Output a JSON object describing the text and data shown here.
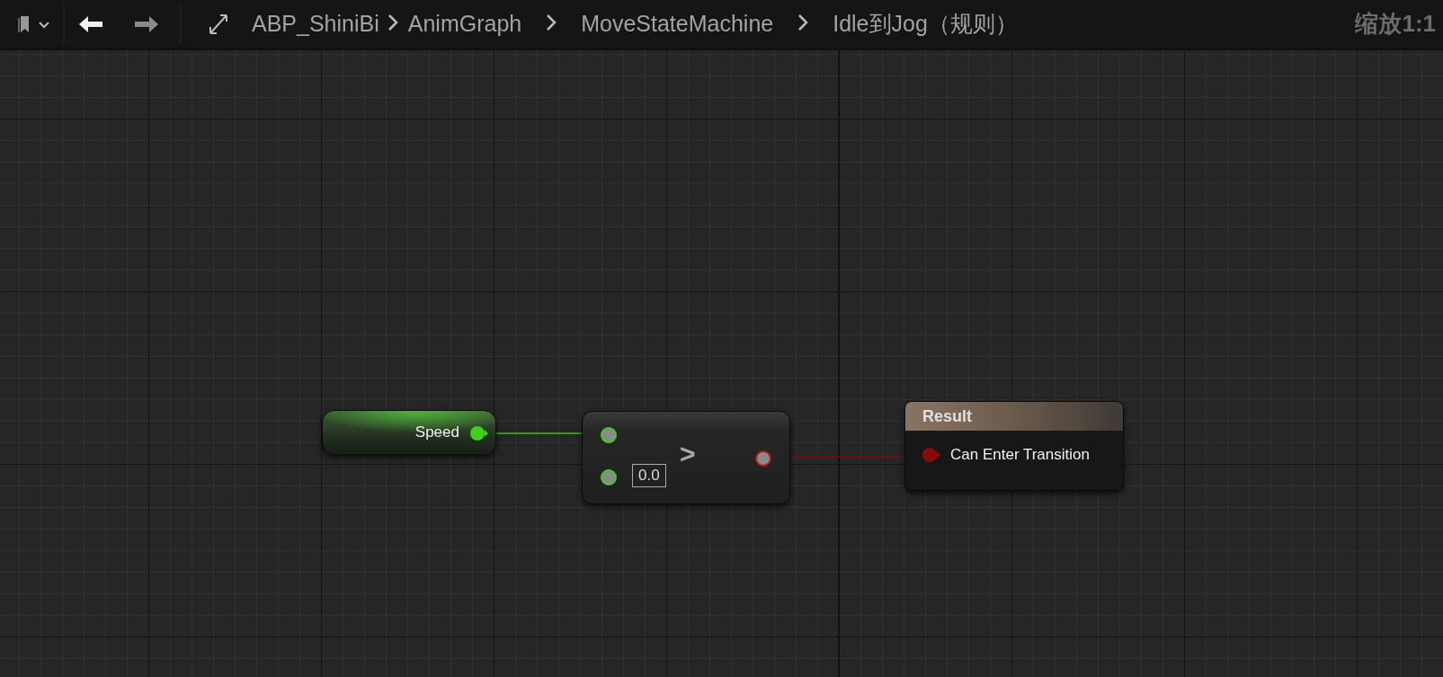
{
  "toolbar": {
    "breadcrumbs": [
      {
        "label": "ABP_ShiniBi"
      },
      {
        "label": "AnimGraph"
      },
      {
        "label": "MoveStateMachine"
      },
      {
        "label": "Idle到Jog（规则）"
      }
    ],
    "zoom": "缩放1:1"
  },
  "nodes": [
    {
      "kind": "variable",
      "label": "Speed"
    },
    {
      "kind": "compare",
      "operator": ">",
      "default_value": "0.0"
    },
    {
      "kind": "result",
      "title": "Result",
      "pin": "Can Enter Transition"
    }
  ]
}
